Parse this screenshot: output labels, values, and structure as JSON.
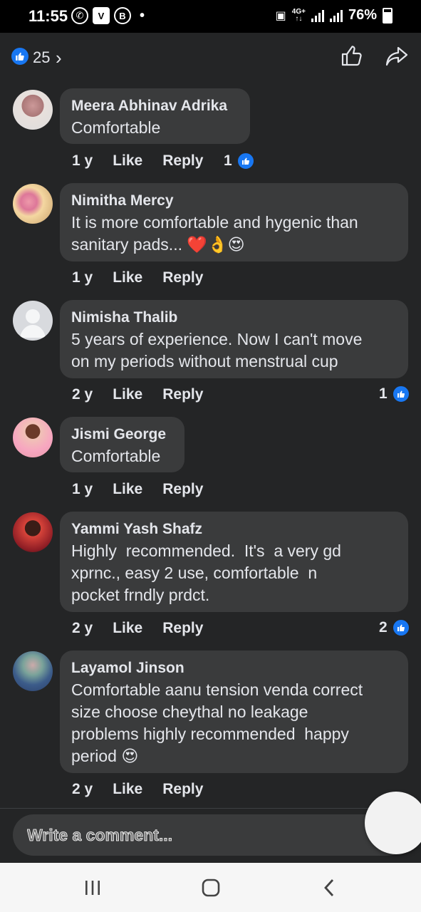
{
  "status_bar": {
    "time": "11:55",
    "left_icons": [
      "whatsapp-icon",
      "v-app-icon",
      "b-app-icon"
    ],
    "network": "4G+",
    "battery": "76%"
  },
  "header": {
    "reaction_count": "25",
    "icons": [
      "thumbs-up-outline-icon",
      "share-arrow-icon"
    ]
  },
  "comments": [
    {
      "name": "Meera Abhinav Adrika",
      "text": "Comfortable",
      "time": "1 y",
      "like": "Like",
      "reply": "Reply",
      "reactions": "1"
    },
    {
      "name": "Nimitha Mercy",
      "text": "It is more comfortable and hygenic than\nsanitary pads... ❤️👌😍",
      "time": "1 y",
      "like": "Like",
      "reply": "Reply",
      "reactions": ""
    },
    {
      "name": "Nimisha Thalib",
      "text": "5 years of experience. Now I can't move\non my periods without menstrual cup",
      "time": "2 y",
      "like": "Like",
      "reply": "Reply",
      "reactions": "1"
    },
    {
      "name": "Jismi George",
      "text": "Comfortable",
      "time": "1 y",
      "like": "Like",
      "reply": "Reply",
      "reactions": ""
    },
    {
      "name": "Yammi Yash Shafz",
      "text": "Highly  recommended.  It's  a very gd\nxprnc., easy 2 use, comfortable  n\npocket frndly prdct.",
      "time": "2 y",
      "like": "Like",
      "reply": "Reply",
      "reactions": "2"
    },
    {
      "name": "Layamol Jinson",
      "text": "Comfortable aanu tension venda correct\nsize choose cheythal no leakage\nproblems highly recommended  happy\nperiod 😍",
      "time": "2 y",
      "like": "Like",
      "reply": "Reply",
      "reactions": ""
    }
  ],
  "composer": {
    "placeholder": "Write a comment..."
  },
  "colors": {
    "accent": "#1877f2",
    "background": "#242526",
    "bubble": "#3a3b3c"
  }
}
